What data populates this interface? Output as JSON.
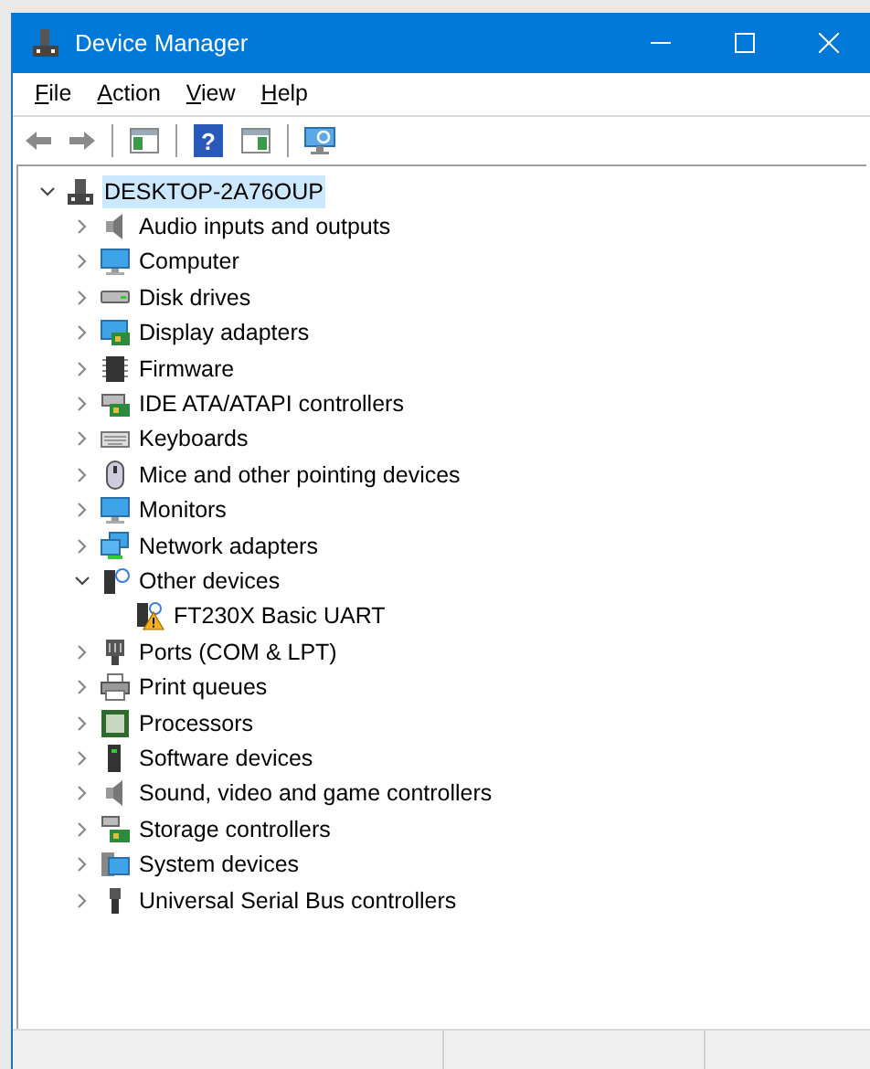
{
  "window": {
    "title": "Device Manager"
  },
  "menu": [
    {
      "label": "File"
    },
    {
      "label": "Action"
    },
    {
      "label": "View"
    },
    {
      "label": "Help"
    }
  ],
  "toolbar": [
    {
      "kind": "back",
      "disabled": true
    },
    {
      "kind": "forward",
      "disabled": true
    },
    {
      "kind": "separator"
    },
    {
      "kind": "console"
    },
    {
      "kind": "separator"
    },
    {
      "kind": "help",
      "label": "?"
    },
    {
      "kind": "pane"
    },
    {
      "kind": "separator"
    },
    {
      "kind": "scan"
    }
  ],
  "tree": {
    "label": "DESKTOP-2A76OUP",
    "expanded": true,
    "selected": true,
    "children": [
      {
        "label": "Audio inputs and outputs",
        "expanded": false,
        "selected": false
      },
      {
        "label": "Computer",
        "expanded": false,
        "selected": false
      },
      {
        "label": "Disk drives",
        "expanded": false,
        "selected": false
      },
      {
        "label": "Display adapters",
        "expanded": false,
        "selected": false
      },
      {
        "label": "Firmware",
        "expanded": false,
        "selected": false
      },
      {
        "label": "IDE ATA/ATAPI controllers",
        "expanded": false,
        "selected": false
      },
      {
        "label": "Keyboards",
        "expanded": false,
        "selected": false
      },
      {
        "label": "Mice and other pointing devices",
        "expanded": false,
        "selected": false
      },
      {
        "label": "Monitors",
        "expanded": false,
        "selected": false
      },
      {
        "label": "Network adapters",
        "expanded": false,
        "selected": false
      },
      {
        "label": "Other devices",
        "expanded": true,
        "selected": false,
        "children": [
          {
            "label": "FT230X Basic UART",
            "selected": false
          }
        ]
      },
      {
        "label": "Ports (COM & LPT)",
        "expanded": false,
        "selected": false
      },
      {
        "label": "Print queues",
        "expanded": false,
        "selected": false
      },
      {
        "label": "Processors",
        "expanded": false,
        "selected": false
      },
      {
        "label": "Software devices",
        "expanded": false,
        "selected": false
      },
      {
        "label": "Sound, video and game controllers",
        "expanded": false,
        "selected": false
      },
      {
        "label": "Storage controllers",
        "expanded": false,
        "selected": false
      },
      {
        "label": "System devices",
        "expanded": false,
        "selected": false
      },
      {
        "label": "Universal Serial Bus controllers",
        "expanded": false,
        "selected": false
      }
    ]
  }
}
